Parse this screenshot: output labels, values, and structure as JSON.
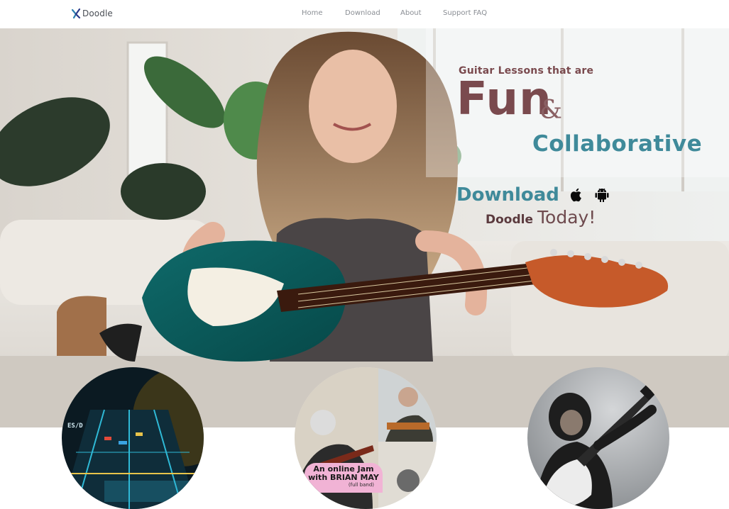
{
  "nav": {
    "brand": "Doodle",
    "links": [
      "Home",
      "Download",
      "About",
      "Support FAQ"
    ]
  },
  "hero": {
    "tagline": "Guitar Lessons that are",
    "word_fun": "Fun",
    "ampersand": "&",
    "word_collab": "Collaborative",
    "download_word": "Download",
    "brand_word": "Doodle",
    "today_word": "Today!",
    "platform_icons": [
      "apple-icon",
      "android-icon"
    ]
  },
  "cards": {
    "game": {
      "hud": "ES/D"
    },
    "jam": {
      "line1": "An online Jam",
      "line2": "with BRIAN MAY",
      "line3": "(full band)"
    },
    "chimp": {}
  },
  "colors": {
    "maroon": "#7a4a4e",
    "teal": "#3f8a9a",
    "nav_text": "#8a8e94",
    "jam_pink": "#f1b3d5"
  }
}
